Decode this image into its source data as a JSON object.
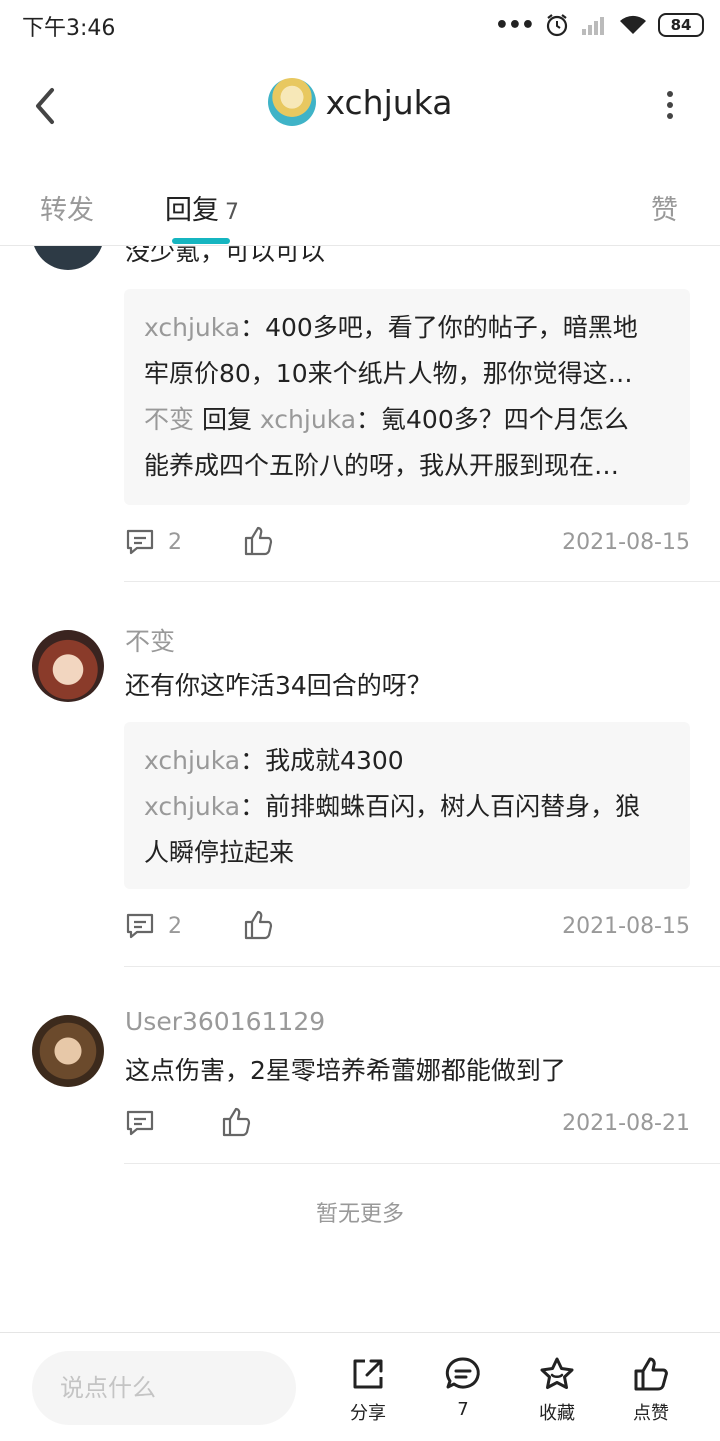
{
  "status": {
    "time": "下午3:46",
    "battery": "84"
  },
  "header": {
    "title": "xchjuka"
  },
  "tabs": {
    "forward": "转发",
    "reply": "回复",
    "reply_count": "7",
    "like": "赞"
  },
  "comments": [
    {
      "text": "没少氪，可以可以",
      "quotes": [
        {
          "name": "xchjuka",
          "text": "：400多吧，看了你的帖子，暗黑地"
        },
        {
          "name": "",
          "text": "牢原价80，10来个纸片人物，那你觉得这…"
        },
        {
          "name": "不变",
          "reply": " 回复 ",
          "name2": "xchjuka",
          "text": "：氪400多？四个月怎么"
        },
        {
          "name": "",
          "text": "能养成四个五阶八的呀，我从开服到现在…"
        }
      ],
      "reply_count": "2",
      "date": "2021-08-15"
    },
    {
      "author": "不变",
      "text": "还有你这咋活34回合的呀？",
      "quotes": [
        {
          "name": "xchjuka",
          "text": "：我成就4300"
        },
        {
          "name": "xchjuka",
          "text": "：前排蜘蛛百闪，树人百闪替身，狼"
        },
        {
          "name": "",
          "text": "人瞬停拉起来"
        }
      ],
      "reply_count": "2",
      "date": "2021-08-15"
    },
    {
      "author": "User360161129",
      "text": "这点伤害，2星零培养希蕾娜都能做到了",
      "reply_count": "",
      "date": "2021-08-21"
    }
  ],
  "no_more": "暂无更多",
  "bottom": {
    "input_placeholder": "说点什么",
    "share": "分享",
    "comment_count": "7",
    "collect": "收藏",
    "like": "点赞"
  },
  "colors": {
    "accent": "#15b5c0",
    "muted": "#999999"
  }
}
